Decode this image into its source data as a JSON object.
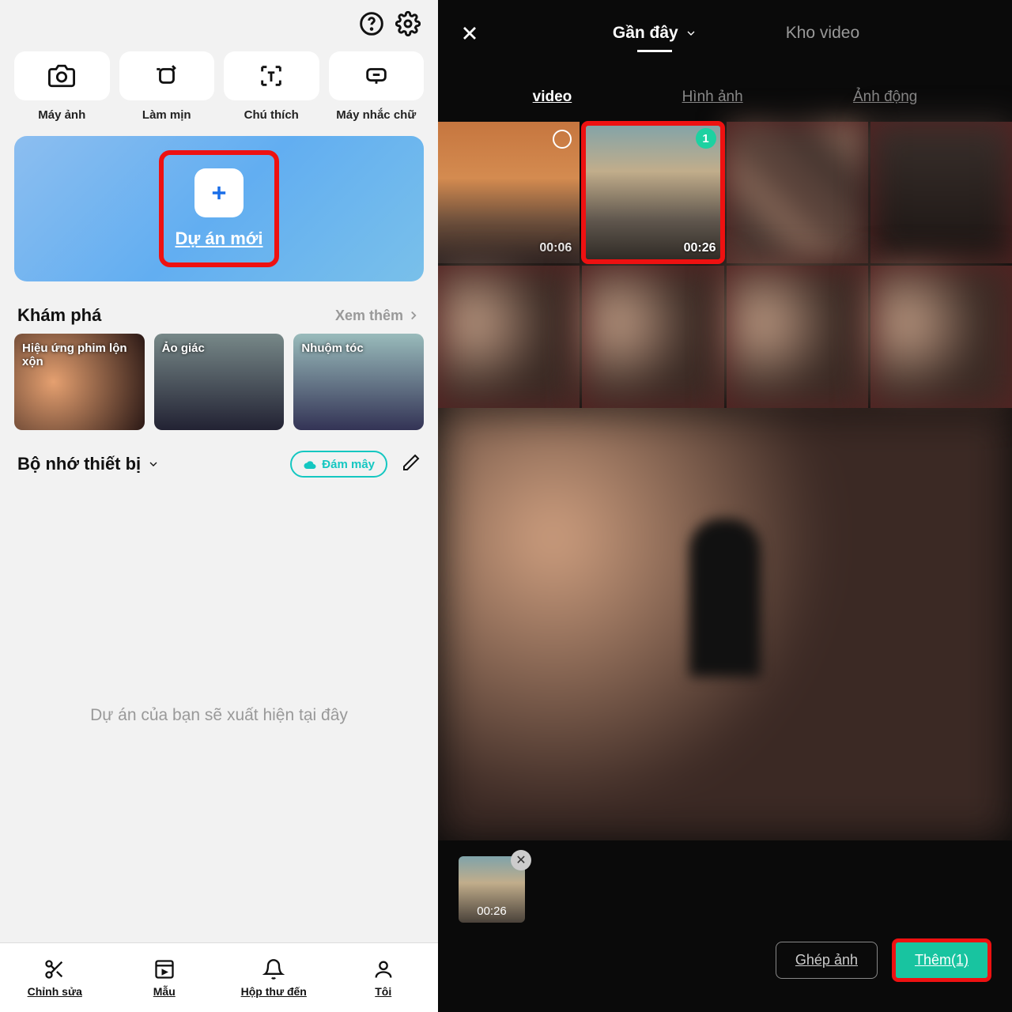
{
  "left": {
    "tools": [
      {
        "label": "Máy ảnh"
      },
      {
        "label": "Làm mịn"
      },
      {
        "label": "Chú thích"
      },
      {
        "label": "Máy nhắc chữ"
      }
    ],
    "new_project": "Dự án mới",
    "discover": {
      "title": "Khám phá",
      "more": "Xem thêm",
      "cards": [
        {
          "label": "Hiệu ứng phim lộn xộn"
        },
        {
          "label": "Ảo giác"
        },
        {
          "label": "Nhuộm tóc"
        }
      ]
    },
    "storage": {
      "title": "Bộ nhớ thiết bị",
      "cloud": "Đám mây"
    },
    "empty_text": "Dự án của bạn sẽ xuất hiện tại đây",
    "nav": [
      {
        "label": "Chỉnh sửa"
      },
      {
        "label": "Mẫu"
      },
      {
        "label": "Hộp thư đến"
      },
      {
        "label": "Tôi"
      }
    ]
  },
  "right": {
    "source_tabs": {
      "active": "Gần đây",
      "other": "Kho video"
    },
    "media_tabs": [
      "video",
      "Hình ảnh",
      "Ảnh động"
    ],
    "thumbs": [
      {
        "duration": "00:06",
        "selected": false
      },
      {
        "duration": "00:26",
        "selected": true,
        "badge": "1"
      }
    ],
    "selected_strip": {
      "duration": "00:26"
    },
    "actions": {
      "ghep": "Ghép ảnh",
      "them": "Thêm(1)"
    }
  }
}
